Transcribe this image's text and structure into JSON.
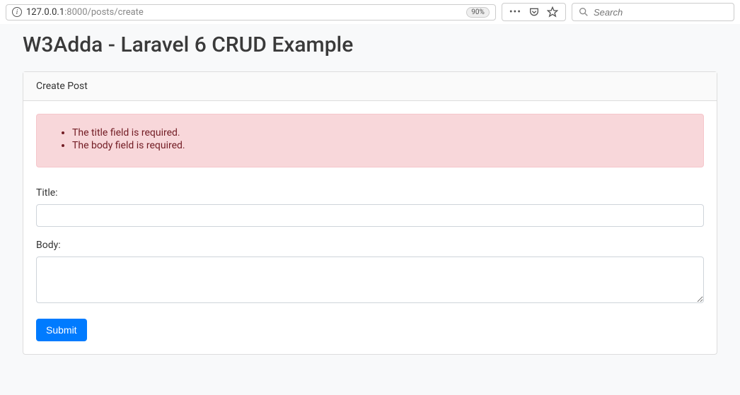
{
  "browser": {
    "url_prefix": "127.0.0.1",
    "url_path": ":8000/posts/create",
    "zoom": "90%",
    "search_placeholder": "Search"
  },
  "page": {
    "title": "W3Adda - Laravel 6 CRUD Example"
  },
  "card": {
    "header": "Create Post"
  },
  "errors": [
    "The title field is required.",
    "The body field is required."
  ],
  "form": {
    "title_label": "Title:",
    "title_value": "",
    "body_label": "Body:",
    "body_value": "",
    "submit_label": "Submit"
  }
}
